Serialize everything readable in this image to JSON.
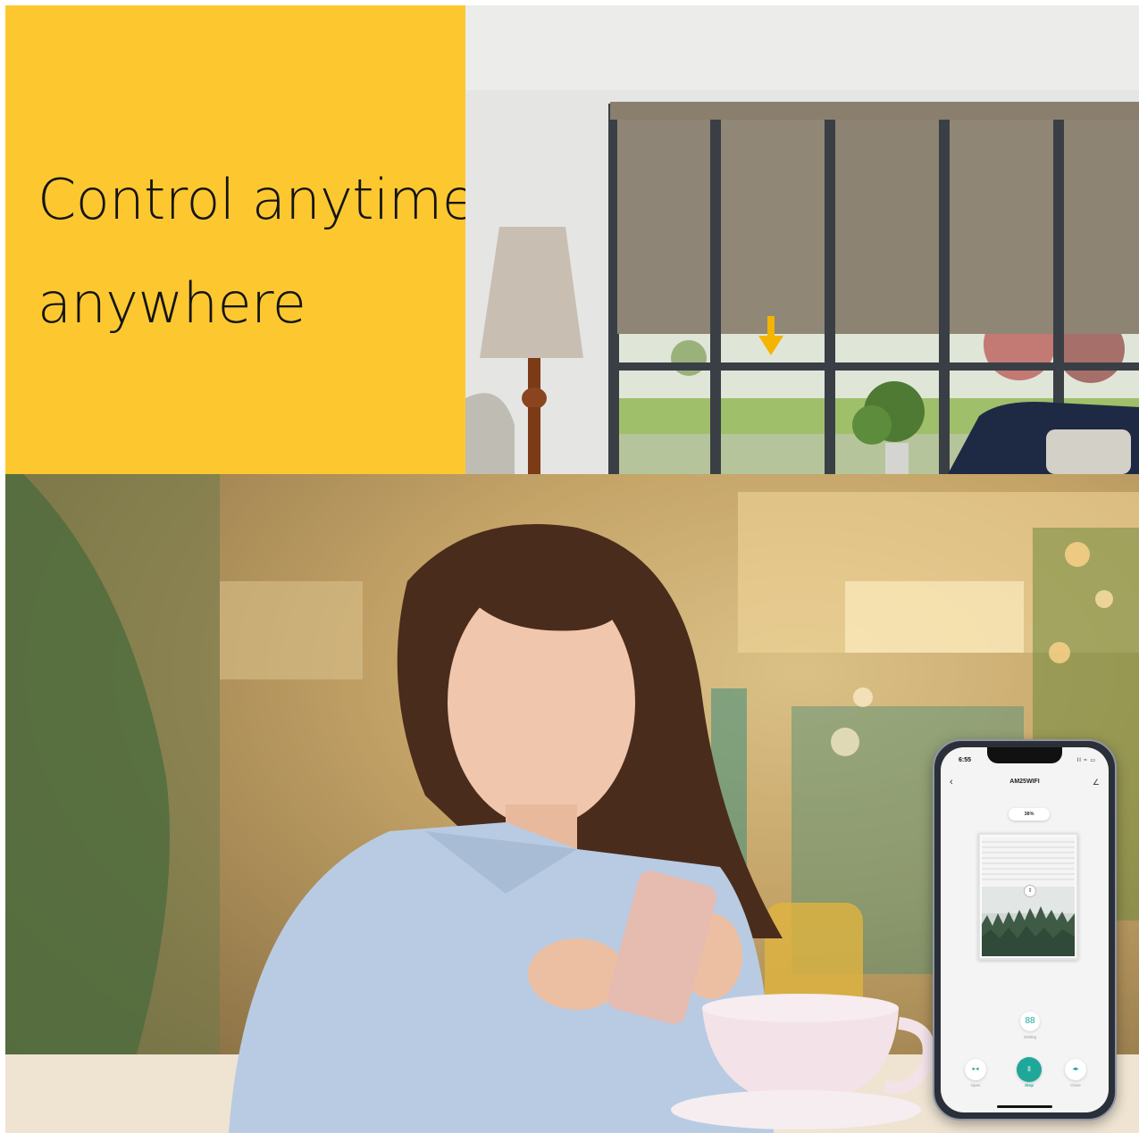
{
  "headline": {
    "line1": "Control anytime",
    "line2": "anywhere"
  },
  "colors": {
    "accent_yellow": "#fdc82f",
    "app_teal": "#1fa79a",
    "arrow_orange": "#f4b400"
  },
  "phone": {
    "status_time": "6:55",
    "status_icons": "ll ≈ ▭",
    "title": "AM25WIFI",
    "back_icon": "‹",
    "edit_icon": "∠",
    "percent": "38%",
    "drag_icon": "⇕",
    "setting_icon": "88",
    "setting_label": "Setting",
    "controls": {
      "open_icon": "▸◂",
      "open_label": "Open",
      "stop_icon": "ll",
      "stop_label": "Stop",
      "close_icon": "◂▸",
      "close_label": "Close"
    }
  }
}
